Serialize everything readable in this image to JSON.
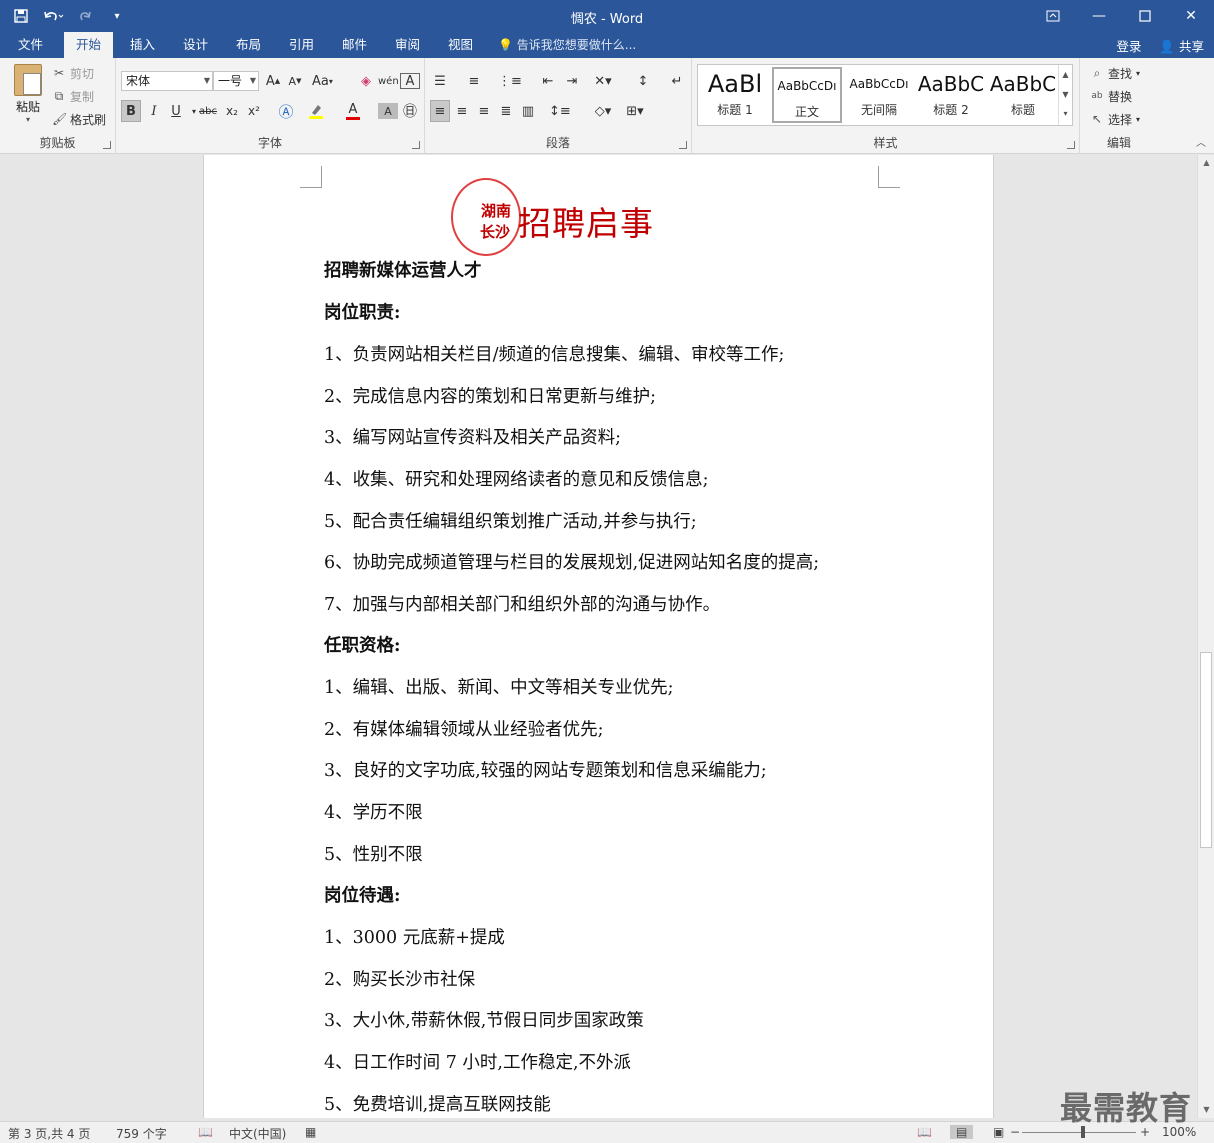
{
  "window": {
    "title": "惆农 - Word",
    "qat": {
      "save_icon": "save-icon",
      "undo_icon": "undo-icon",
      "redo_icon": "redo-icon",
      "customize_icon": "customize-qat-icon"
    }
  },
  "tabs": {
    "items": [
      "文件",
      "开始",
      "插入",
      "设计",
      "布局",
      "引用",
      "邮件",
      "审阅",
      "视图"
    ],
    "active": "开始",
    "tell_me": "告诉我您想要做什么...",
    "login": "登录",
    "share": "共享"
  },
  "clipboard": {
    "paste": "粘贴",
    "cut": "剪切",
    "copy": "复制",
    "format_painter": "格式刷",
    "label": "剪贴板"
  },
  "font": {
    "name": "宋体",
    "size": "一号",
    "grow": "A",
    "shrink": "A",
    "case": "Aa",
    "bold": "B",
    "italic": "I",
    "underline": "U",
    "strikethrough": "abc",
    "subscript": "x₂",
    "superscript": "x²",
    "color_letter": "A",
    "label": "字体",
    "accent_color": "#e00000",
    "highlight_color": "#ffff00"
  },
  "paragraph": {
    "label": "段落"
  },
  "styles": {
    "items": [
      {
        "sample": "AaBl",
        "name": "标题 1"
      },
      {
        "sample": "AaBbCcDı",
        "name": "正文"
      },
      {
        "sample": "AaBbCcDı",
        "name": "无间隔"
      },
      {
        "sample": "AaBbC",
        "name": "标题 2"
      },
      {
        "sample": "AaBbC",
        "name": "标题"
      }
    ],
    "selected": 1,
    "label": "样式"
  },
  "editing": {
    "find": "查找",
    "replace": "替换",
    "select": "选择",
    "label": "编辑"
  },
  "document": {
    "seal_line1": "湖南",
    "seal_line2": "长沙",
    "title": "招聘启事",
    "seal_color": "#c00000",
    "lines": [
      {
        "text": "招聘新媒体运营人才",
        "bold": true
      },
      {
        "text": "岗位职责:",
        "bold": true
      },
      {
        "text": "1、负责网站相关栏目/频道的信息搜集、编辑、审校等工作;",
        "bold": false
      },
      {
        "text": "2、完成信息内容的策划和日常更新与维护;",
        "bold": false
      },
      {
        "text": "3、编写网站宣传资料及相关产品资料;",
        "bold": false
      },
      {
        "text": "4、收集、研究和处理网络读者的意见和反馈信息;",
        "bold": false
      },
      {
        "text": "5、配合责任编辑组织策划推广活动,并参与执行;",
        "bold": false
      },
      {
        "text": "6、协助完成频道管理与栏目的发展规划,促进网站知名度的提高;",
        "bold": false
      },
      {
        "text": "7、加强与内部相关部门和组织外部的沟通与协作。",
        "bold": false
      },
      {
        "text": "任职资格:",
        "bold": true
      },
      {
        "text": "1、编辑、出版、新闻、中文等相关专业优先;",
        "bold": false
      },
      {
        "text": "2、有媒体编辑领域从业经验者优先;",
        "bold": false
      },
      {
        "text": "3、良好的文字功底,较强的网站专题策划和信息采编能力;",
        "bold": false
      },
      {
        "text": "4、学历不限",
        "bold": false
      },
      {
        "text": "5、性别不限",
        "bold": false
      },
      {
        "text": "岗位待遇:",
        "bold": true
      },
      {
        "text": "1、3000 元底薪+提成",
        "bold": false
      },
      {
        "text": "2、购买长沙市社保",
        "bold": false
      },
      {
        "text": "3、大小休,带薪休假,节假日同步国家政策",
        "bold": false
      },
      {
        "text": "4、日工作时间 7 小时,工作稳定,不外派",
        "bold": false
      },
      {
        "text": "5、免费培训,提高互联网技能",
        "bold": false
      }
    ]
  },
  "status": {
    "page": "第 3 页,共 4 页",
    "words": "759 个字",
    "language": "中文(中国)",
    "zoom": "100%",
    "zoom_level": 1.0
  },
  "watermark": "最需教育"
}
